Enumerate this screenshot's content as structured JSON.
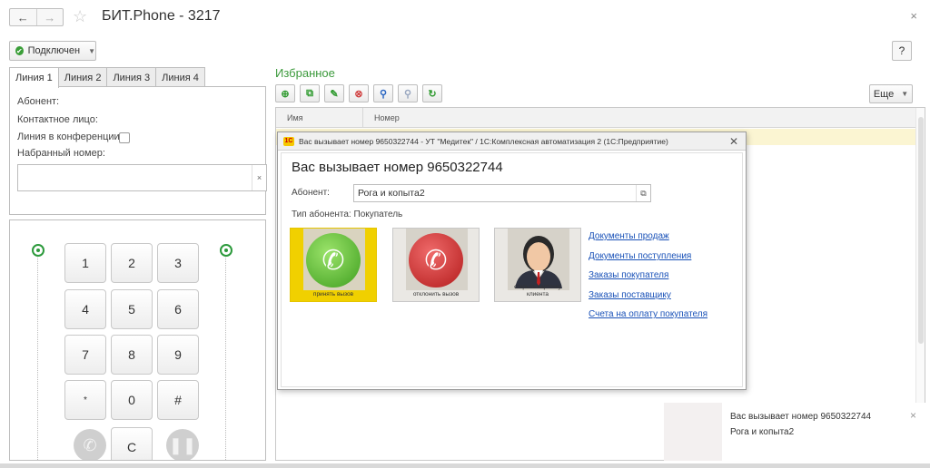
{
  "window": {
    "title": "БИТ.Phone - 3217",
    "back_icon": "←",
    "forward_icon": "→",
    "favorite_icon": "☆",
    "close_icon": "×"
  },
  "status": {
    "label": "Подключен",
    "color": "#3a9e38"
  },
  "help": {
    "label": "?"
  },
  "lines": {
    "tabs": [
      {
        "label": "Линия 1",
        "active": true
      },
      {
        "label": "Линия 2",
        "active": false
      },
      {
        "label": "Линия 3",
        "active": false
      },
      {
        "label": "Линия 4",
        "active": false
      }
    ],
    "subscriber_label": "Абонент:",
    "contact_label": "Контактное лицо:",
    "conference_label": "Линия в конференции:",
    "conference_checked": false,
    "dialed_label": "Набранный номер:",
    "dialed_value": "",
    "clear_icon": "×"
  },
  "keypad": {
    "keys": [
      "1",
      "2",
      "3",
      "4",
      "5",
      "6",
      "7",
      "8",
      "9",
      "*",
      "0",
      "#"
    ],
    "clear_key": "C"
  },
  "favorites": {
    "title": "Избранное",
    "more_label": "Еще",
    "columns": [
      "Имя",
      "Номер"
    ],
    "toolbar_icons": [
      "add-icon",
      "copy-icon",
      "edit-icon",
      "delete-icon",
      "search-icon",
      "search-cancel-icon",
      "refresh-icon"
    ]
  },
  "dialog": {
    "title": "Вас вызывает номер 9650322744 - УТ \"Медитек\" / 1С:Комплексная автоматизация 2  (1С:Предприятие)",
    "logo": "1С",
    "heading": "Вас вызывает номер 9650322744",
    "subscriber_label": "Абонент:",
    "subscriber_value": "Рога и копыта2",
    "type_label": "Тип абонента:",
    "type_value": "Покупатель",
    "accept_caption": "принять вызов",
    "reject_caption": "отклонить вызов",
    "card_caption": "открыть карточку клиента",
    "links": [
      "Документы продаж",
      "Документы поступления",
      "Заказы покупателя",
      "Заказы поставщику",
      "Счета на оплату покупателя"
    ]
  },
  "notification": {
    "title": "Вас вызывает номер 9650322744",
    "text": "Рога и копыта2"
  },
  "colors": {
    "accent_green": "#3c9a3c",
    "link_blue": "#1a52b8",
    "accept_yellow": "#f0d000",
    "selected_row": "#fbf5d2"
  }
}
